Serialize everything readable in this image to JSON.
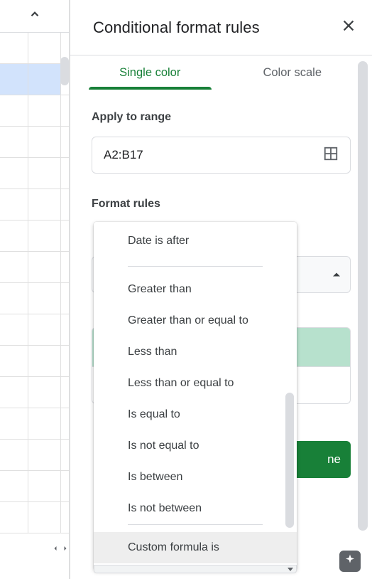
{
  "header": {
    "title": "Conditional format rules"
  },
  "tabs": {
    "single": "Single color",
    "scale": "Color scale"
  },
  "range": {
    "label": "Apply to range",
    "value": "A2:B17"
  },
  "rules": {
    "label": "Format rules"
  },
  "done_label": "ne",
  "dropdown": {
    "option_date_after": "Date is after",
    "option_gt": "Greater than",
    "option_gte": "Greater than or equal to",
    "option_lt": "Less than",
    "option_lte": "Less than or equal to",
    "option_eq": "Is equal to",
    "option_neq": "Is not equal to",
    "option_between": "Is between",
    "option_nbetween": "Is not between",
    "option_custom": "Custom formula is"
  }
}
